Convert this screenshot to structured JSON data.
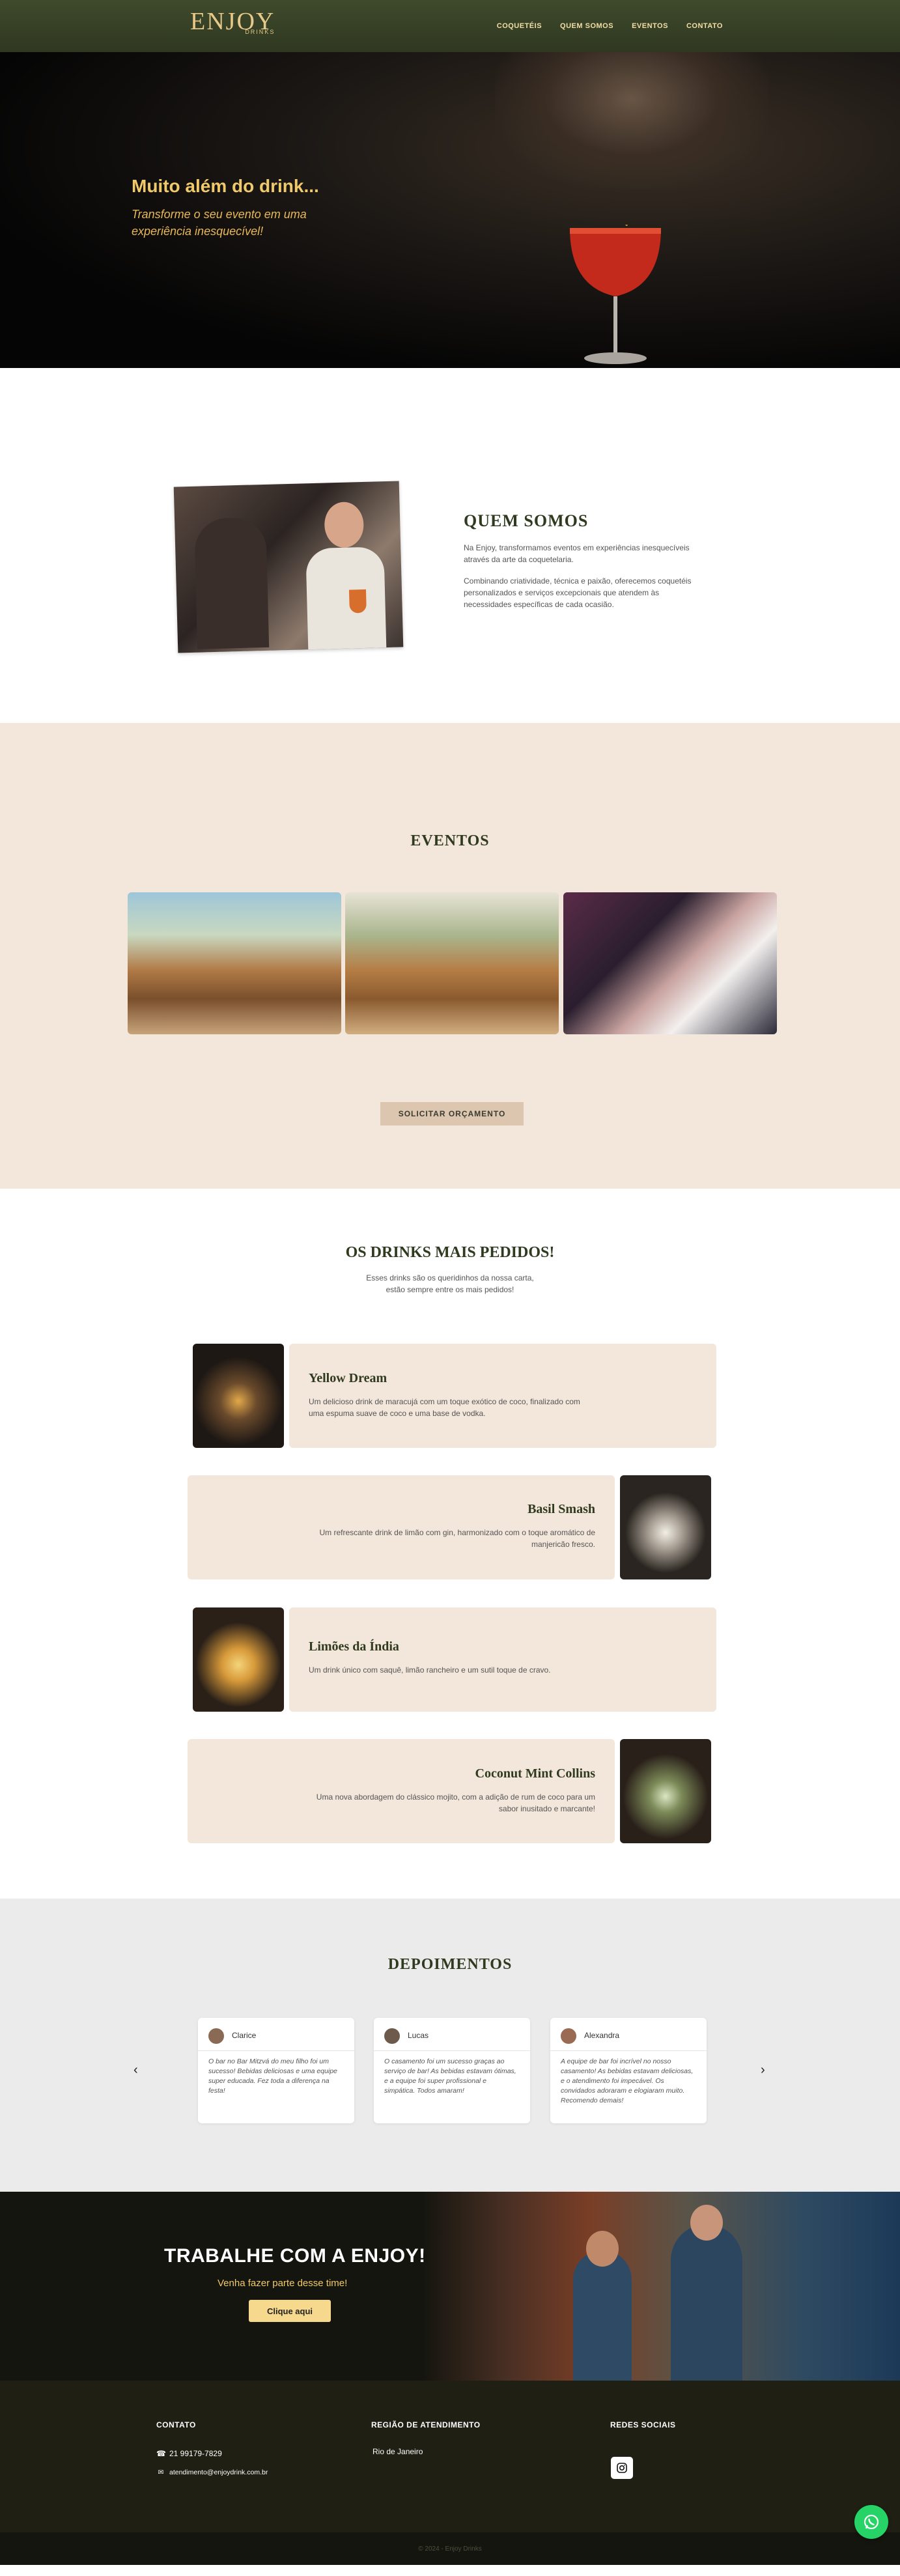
{
  "header": {
    "logo_main": "ENJOY",
    "logo_sub": "DRINKS",
    "nav": [
      "COQUETÉIS",
      "QUEM SOMOS",
      "EVENTOS",
      "CONTATO"
    ]
  },
  "hero": {
    "title": "Muito além do drink...",
    "subtitle": "Transforme o seu evento em uma experiência inesquecível!"
  },
  "quem_somos": {
    "title": "QUEM SOMOS",
    "p1": "Na Enjoy, transformamos eventos em experiências inesquecíveis através da arte da coquetelaria.",
    "p2": "Combinando criatividade, técnica e paixão, oferecemos coquetéis personalizados e serviços excepcionais que atendem às necessidades específicas de cada ocasião."
  },
  "eventos": {
    "title": "EVENTOS",
    "button": "SOLICITAR ORÇAMENTO"
  },
  "drinks": {
    "title": "OS DRINKS MAIS PEDIDOS!",
    "subtitle_1": "Esses drinks são os queridinhos da nossa carta,",
    "subtitle_2": "estão sempre entre os mais pedidos!",
    "items": [
      {
        "name": "Yellow Dream",
        "desc": "Um delicioso drink de maracujá com um toque exótico de coco, finalizado com uma espuma suave de coco e uma base de vodka."
      },
      {
        "name": "Basil Smash",
        "desc": "Um refrescante drink de limão com gin, harmonizado com o toque aromático de manjericão fresco."
      },
      {
        "name": "Limões da Índia",
        "desc": "Um drink único com saquê, limão rancheiro e um sutil toque de cravo."
      },
      {
        "name": "Coconut Mint Collins",
        "desc": "Uma nova abordagem do clássico mojito, com a adição de rum de coco para um sabor inusitado e marcante!"
      }
    ]
  },
  "depoimentos": {
    "title": "DEPOIMENTOS",
    "prev": "‹",
    "next": "›",
    "items": [
      {
        "name": "Clarice",
        "text": "O bar no Bar Mitzvá do meu filho foi um sucesso! Bebidas deliciosas e uma equipe super educada. Fez toda a diferença na festa!"
      },
      {
        "name": "Lucas",
        "text": "O casamento foi um sucesso graças ao serviço de bar! As bebidas estavam ótimas, e a equipe foi super profissional e simpática. Todos amaram!"
      },
      {
        "name": "Alexandra",
        "text": "A equipe de bar foi incrível no nosso casamento! As bebidas estavam deliciosas, e o atendimento foi impecável. Os convidados adoraram e elogiaram muito. Recomendo demais!"
      }
    ]
  },
  "trabalhe": {
    "title": "TRABALHE COM A ENJOY!",
    "subtitle": "Venha fazer parte desse time!",
    "button": "Clique aqui"
  },
  "footer": {
    "contato_title": "CONTATO",
    "phone": "21 99179-7829",
    "email": "atendimento@enjoydrink.com.br",
    "regiao_title": "REGIÃO DE ATENDIMENTO",
    "regiao": "Rio de Janeiro",
    "redes_title": "REDES SOCIAIS",
    "copyright": "© 2024 - Enjoy Drinks"
  },
  "icons": {
    "phone": "phone-icon",
    "email": "envelope-icon",
    "instagram": "instagram-icon",
    "whatsapp": "whatsapp-icon"
  }
}
